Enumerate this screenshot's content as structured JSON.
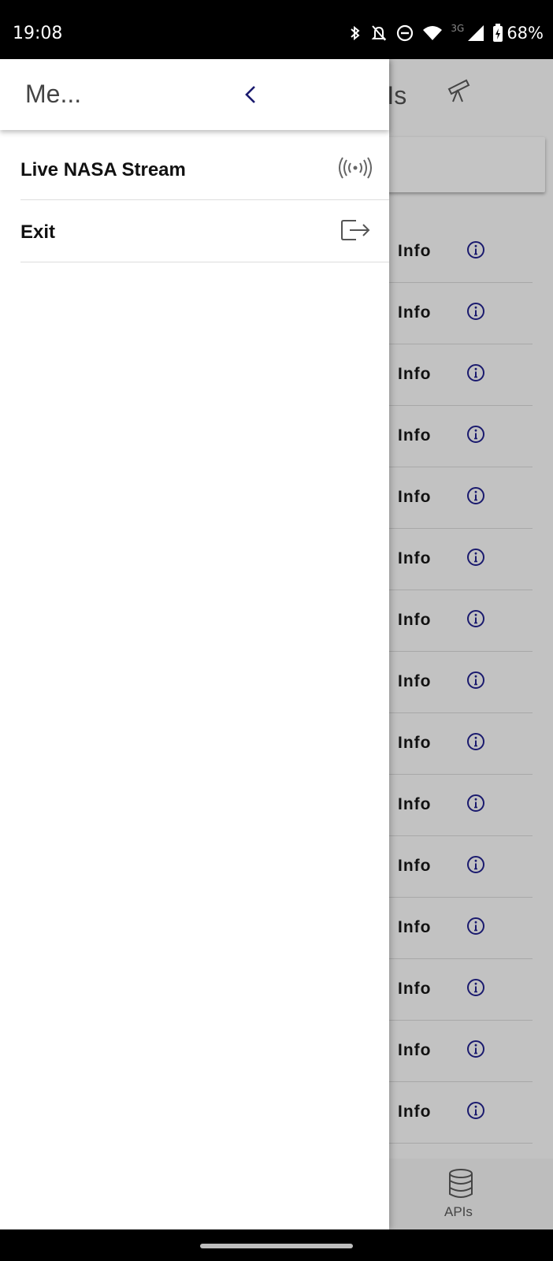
{
  "status_bar": {
    "time": "19:08",
    "network_label": "3G",
    "battery_percent": "68%",
    "icons": [
      "bluetooth-icon",
      "notifications-off-icon",
      "do-not-disturb-icon",
      "wifi-icon",
      "cellular-signal-icon",
      "battery-charging-icon"
    ]
  },
  "app": {
    "title_partial": "PIs",
    "header_icon": "telescope-icon",
    "api_rows": [
      {
        "label": "Info"
      },
      {
        "label": "Info"
      },
      {
        "label": "Info"
      },
      {
        "label": "Info"
      },
      {
        "label": "Info"
      },
      {
        "label": "Info"
      },
      {
        "label": "Info"
      },
      {
        "label": "Info"
      },
      {
        "label": "Info"
      },
      {
        "label": "Info"
      },
      {
        "label": "Info"
      },
      {
        "label": "Info"
      },
      {
        "label": "Info"
      },
      {
        "label": "Info"
      },
      {
        "label": "Info"
      }
    ],
    "bottom_nav": {
      "label": "APIs",
      "icon": "database-icon"
    }
  },
  "drawer": {
    "title": "Me...",
    "back_icon": "chevron-left-icon",
    "items": [
      {
        "label": "Live NASA Stream",
        "icon": "broadcast-icon"
      },
      {
        "label": "Exit",
        "icon": "logout-icon"
      }
    ]
  },
  "colors": {
    "accent": "#1a1a6e",
    "overlay": "#c2c2c2",
    "drawer_bg": "#ffffff"
  }
}
